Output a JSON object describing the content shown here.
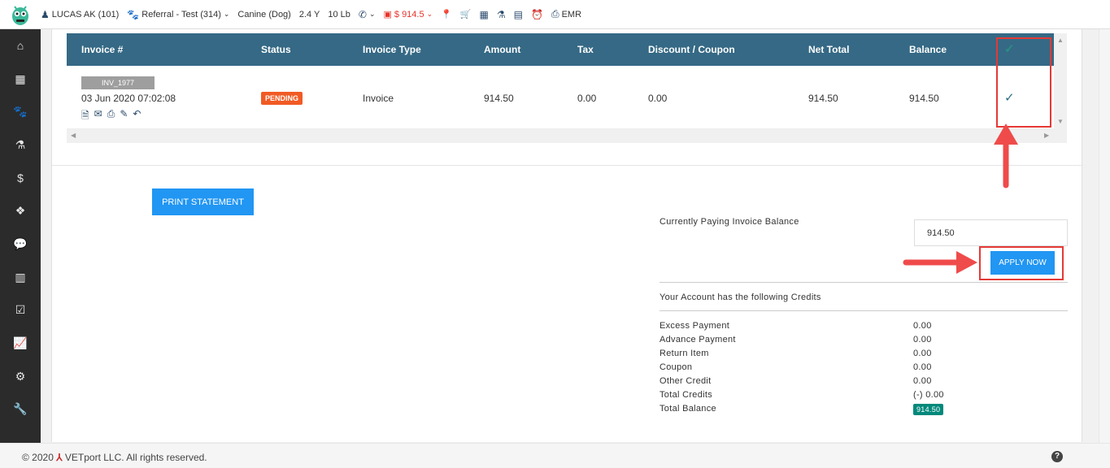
{
  "topbar": {
    "patient": "LUCAS AK (101)",
    "referral": "Referral - Test (314)",
    "species": "Canine (Dog)",
    "age": "2.4 Y",
    "weight": "10 Lb",
    "balance": "$ 914.5",
    "emr": "EMR"
  },
  "sidebar": {
    "icons": [
      "home-icon",
      "calendar-icon",
      "paw-icon",
      "flask-icon",
      "dollar-icon",
      "dropbox-icon",
      "chat-icon",
      "building-icon",
      "checkbox-icon",
      "chart-icon",
      "gear-icon",
      "wrench-icon"
    ]
  },
  "table": {
    "headers": {
      "invoice": "Invoice #",
      "status": "Status",
      "type": "Invoice Type",
      "amount": "Amount",
      "tax": "Tax",
      "discount": "Discount / Coupon",
      "net": "Net Total",
      "balance": "Balance"
    },
    "row": {
      "invoice_id": "INV_1977",
      "datetime": "03 Jun 2020 07:02:08",
      "status": "PENDING",
      "type": "Invoice",
      "amount": "914.50",
      "tax": "0.00",
      "discount": "0.00",
      "net": "914.50",
      "balance": "914.50"
    }
  },
  "actions": {
    "print_statement": "PRINT STATEMENT",
    "apply_now": "APPLY NOW"
  },
  "payment": {
    "label": "Currently Paying Invoice Balance",
    "value": "914.50"
  },
  "credits": {
    "title": "Your Account has the following Credits",
    "rows": [
      {
        "label": "Excess Payment",
        "value": "0.00"
      },
      {
        "label": "Advance Payment",
        "value": "0.00"
      },
      {
        "label": "Return Item",
        "value": "0.00"
      },
      {
        "label": "Coupon",
        "value": "0.00"
      },
      {
        "label": "Other Credit",
        "value": "0.00"
      },
      {
        "label": "Total Credits",
        "value": "(-) 0.00"
      }
    ],
    "total_label": "Total Balance",
    "total_value": "914.50"
  },
  "footer": {
    "copyright_prefix": "© 2020",
    "copyright_suffix": "VETport LLC. All rights reserved.",
    "help": "?"
  },
  "colors": {
    "header_bg": "#356985",
    "accent_blue": "#2196f3",
    "pending": "#f15a24",
    "total_badge": "#00897b",
    "highlight": "#e53935"
  }
}
